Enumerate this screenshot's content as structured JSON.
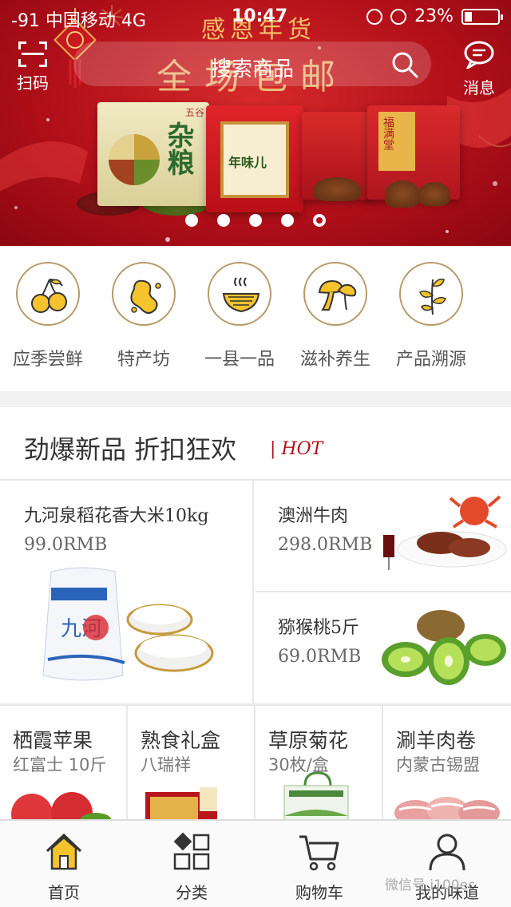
{
  "status_bar": {
    "carrier": "-91 中国移动  4G",
    "time": "10:47",
    "battery": "23%",
    "battery_level": 0.23
  },
  "header": {
    "scan_label": "扫码",
    "search_placeholder": "搜索商品",
    "message_label": "消息"
  },
  "banner": {
    "headline": "感恩年货",
    "slogan": "全场包邮",
    "product_texts": [
      "杂粮",
      "五谷",
      "年味儿",
      "福满堂"
    ],
    "slide_count": 5,
    "active_slide": 5
  },
  "categories": [
    {
      "label": "应季尝鲜",
      "icon": "cherry-icon"
    },
    {
      "label": "特产坊",
      "icon": "peanut-icon"
    },
    {
      "label": "一县一品",
      "icon": "noodle-bowl-icon"
    },
    {
      "label": "滋补养生",
      "icon": "mushroom-icon"
    },
    {
      "label": "产品溯源",
      "icon": "sprout-icon"
    }
  ],
  "hot_section": {
    "title": "劲爆新品 折扣狂欢",
    "tag": "| HOT"
  },
  "featured": [
    {
      "name": "九河泉稻花香大米10kg",
      "price": "99.0RMB",
      "image": "rice-bag"
    },
    {
      "name": "澳洲牛肉",
      "price": "298.0RMB",
      "image": "steak-plate"
    },
    {
      "name": "猕猴桃5斤",
      "price": "69.0RMB",
      "image": "kiwi-fruit"
    }
  ],
  "products": [
    {
      "name": "栖霞苹果",
      "sub": "红富士 10斤",
      "image": "apples"
    },
    {
      "name": "熟食礼盒",
      "sub": "八瑞祥",
      "image": "gift-box"
    },
    {
      "name": "草原菊花",
      "sub": "30枚/盒",
      "image": "flower-box"
    },
    {
      "name": "涮羊肉卷",
      "sub": "内蒙古锡盟",
      "image": "lamb-rolls"
    }
  ],
  "tabs": [
    {
      "label": "首页",
      "icon": "home-icon",
      "active": true
    },
    {
      "label": "分类",
      "icon": "grid-icon",
      "active": false
    },
    {
      "label": "购物车",
      "icon": "cart-icon",
      "active": false
    },
    {
      "label": "我的味道",
      "icon": "user-icon",
      "active": false
    }
  ],
  "watermark": "微信号 i100ec",
  "colors": {
    "brand_red": "#b3101a",
    "gold": "#b89968",
    "home_yellow": "#f5c32c"
  }
}
